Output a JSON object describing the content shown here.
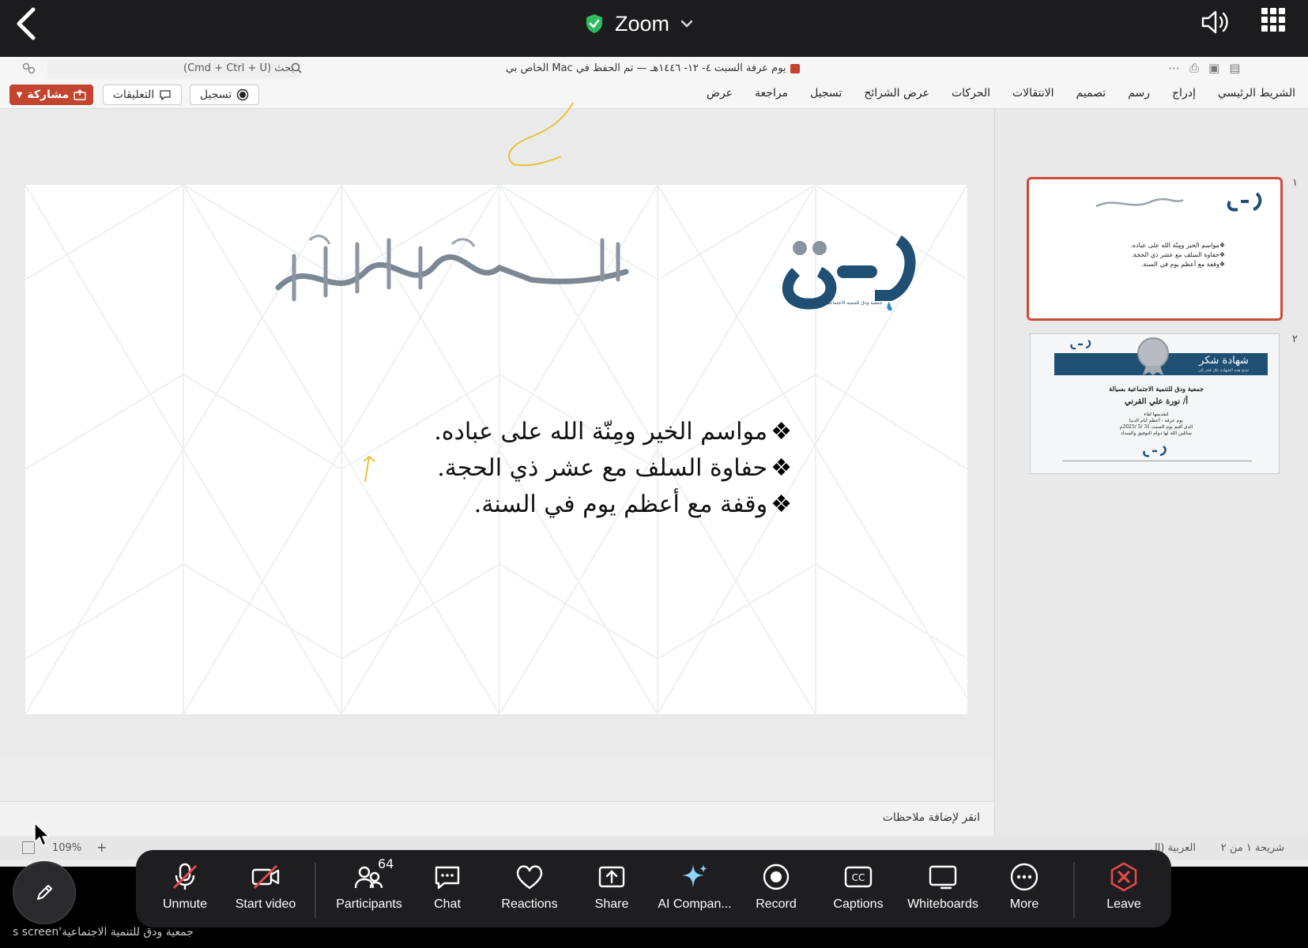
{
  "zoom_top": {
    "title": "Zoom",
    "chevron": "⌄",
    "back_icon": "chevron-left-icon",
    "security_icon": "green-shield-check-icon",
    "speaker_icon": "speaker-icon",
    "apps_icon": "grid-icon"
  },
  "ppt": {
    "search_placeholder": "بحث (Cmd + Ctrl + U)",
    "doc_title": "يوم عرفة السبت ٤- ١٢- ١٤٤٦هـ — تم الحفظ في Mac الخاص بي",
    "ribbon": {
      "share_label": "مشاركة",
      "comments_label": "التعليقات",
      "record_label": "تسجيل",
      "tabs": [
        "الشريط الرئيسي",
        "إدراج",
        "رسم",
        "تصميم",
        "الانتقالات",
        "الحركات",
        "عرض الشرائح",
        "تسجيل",
        "مراجعة",
        "عرض"
      ]
    },
    "slide": {
      "bullets": [
        "مواسم الخير ومِنّة الله على عباده.",
        "حفاوة السلف مع عشر ذي الحجة.",
        "وقفة مع أعظم يوم في السنة."
      ],
      "bullet_marker": "❖",
      "logo_text": "ودق",
      "logo_caption": "جمعية ودق للتنمية الاجتماعية بسيالة"
    },
    "notes_placeholder": "انقر لإضافة ملاحظات",
    "status": {
      "zoom": "109%",
      "plus": "+",
      "language": "العربية (ال",
      "slide_count": "شريحة ١ من ٢"
    },
    "thumbnails": [
      {
        "number": "١",
        "lines": [
          "❖مواسم الخير ومِنّة الله على عباده.",
          "❖حفاوة السلف مع عشر ذي الحجة.",
          "❖وقفة مع أعظم يوم في السنة."
        ]
      },
      {
        "number": "٢",
        "title": "شهادة شكر",
        "subtitle": "تمنح هذه الشهادة بكل فخر إلى",
        "org": "جمعية ودق للتنمية الاجتماعية بسيالة",
        "name": "أ/ نورة علي القرني",
        "body": [
          "لتقديمها لقاء",
          "يوم عرفة - أعظم أيام الدنيا",
          "الذي أقيم يوم السبت 31 /5 /2025م",
          "سائلين الله لها دوام التوفيق والسداد"
        ],
        "logo_text": "ودق"
      }
    ]
  },
  "controls": {
    "items": [
      {
        "label": "Unmute",
        "icon": "mic-muted-icon"
      },
      {
        "label": "Start video",
        "icon": "video-off-icon"
      },
      {
        "label": "Participants",
        "icon": "participants-icon",
        "count": "64"
      },
      {
        "label": "Chat",
        "icon": "chat-icon"
      },
      {
        "label": "Reactions",
        "icon": "heart-icon"
      },
      {
        "label": "Share",
        "icon": "share-screen-icon"
      },
      {
        "label": "AI Compan...",
        "icon": "ai-sparkle-icon"
      },
      {
        "label": "Record",
        "icon": "record-icon"
      },
      {
        "label": "Captions",
        "icon": "cc-icon"
      },
      {
        "label": "Whiteboards",
        "icon": "whiteboard-icon"
      },
      {
        "label": "More",
        "icon": "more-icon"
      },
      {
        "label": "Leave",
        "icon": "leave-icon"
      }
    ],
    "colors": {
      "leave": "#e5484d",
      "ai": "#8fd3ff"
    }
  },
  "bottom_caption": "جمعية ودق للتنمية الاجتماعية's screen"
}
